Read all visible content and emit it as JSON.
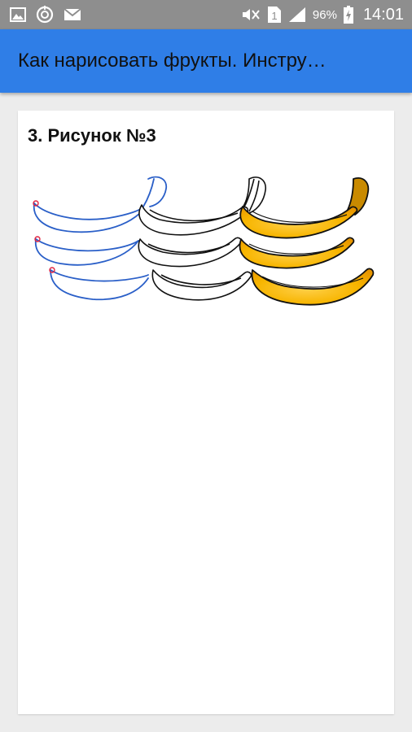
{
  "status_bar": {
    "icons_left": [
      "image-icon",
      "sync-icon",
      "mail-icon"
    ],
    "icons_right": [
      "mute-icon",
      "sim-icon",
      "signal-icon",
      "battery-icon"
    ],
    "sim_label": "1",
    "battery_percent": "96%",
    "time": "14:01"
  },
  "app_bar": {
    "title": "Как нарисовать фрукты. Инстру…",
    "color": "#2f7ee7"
  },
  "content": {
    "section_title": "3. Рисунок №3",
    "image": {
      "icon": "banana-drawing-steps",
      "colors": {
        "sketch_stroke": "#2a5fc8",
        "marker": "#e2233f",
        "ink": "#111111",
        "banana_fill": "#f5b400"
      }
    }
  }
}
